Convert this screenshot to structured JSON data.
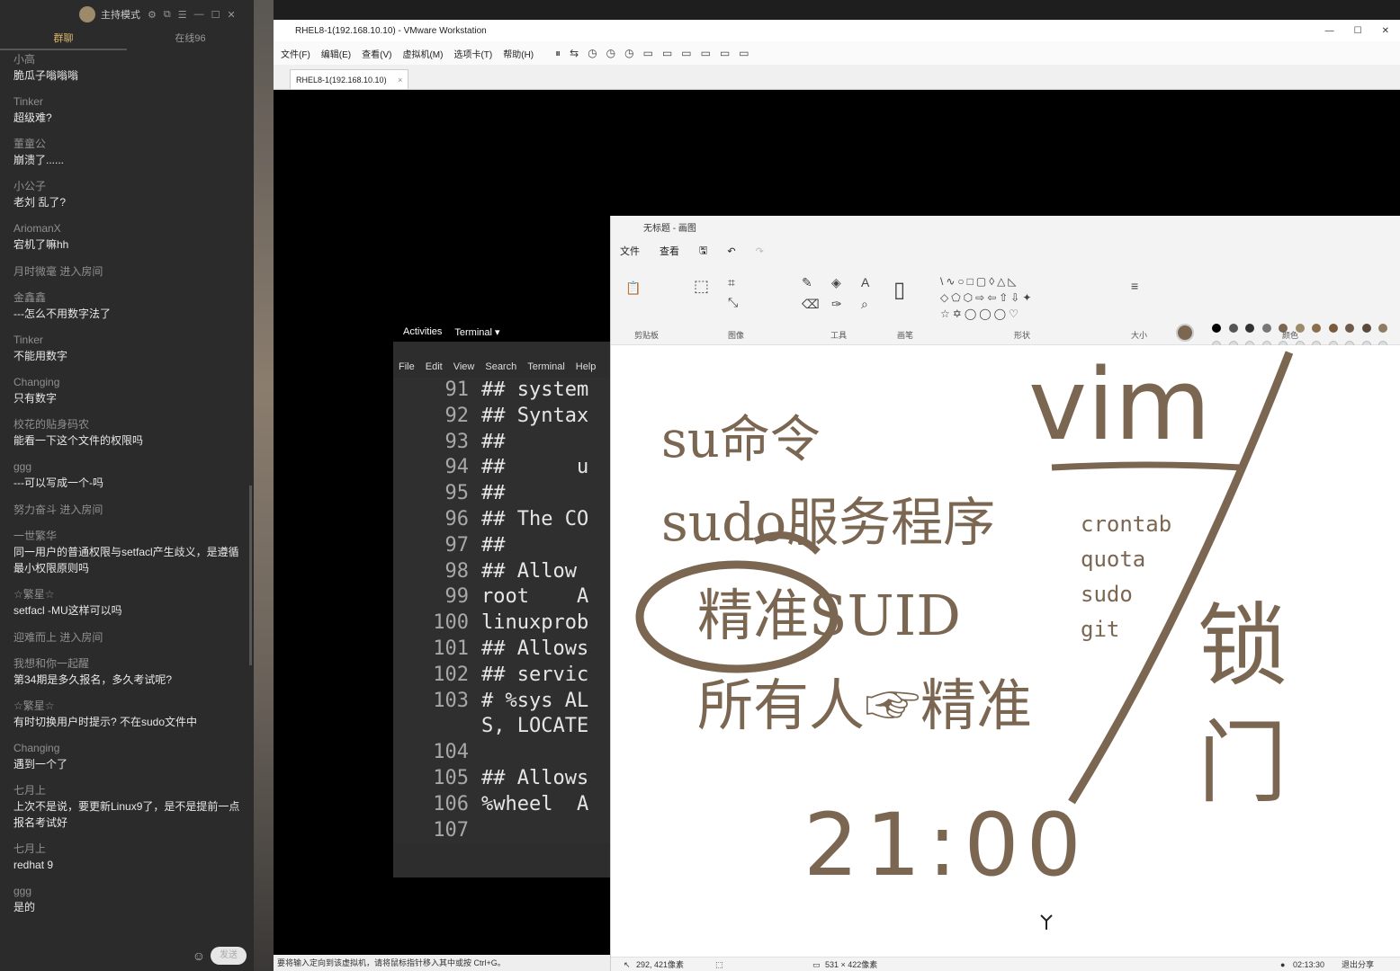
{
  "chat": {
    "host_label": "主持模式",
    "tabs": [
      "群聊",
      "在线96"
    ],
    "messages": [
      {
        "nick": "小高",
        "text": "脆瓜子嗡嗡嗡"
      },
      {
        "nick": "Tinker",
        "text": "超级难?"
      },
      {
        "nick": "董童公",
        "text": "崩溃了......"
      },
      {
        "nick": "小公子",
        "text": "老刘 乱了?"
      },
      {
        "nick": "AriomanX",
        "text": "宕机了嘛hh"
      },
      {
        "system": "月时微毫 进入房间"
      },
      {
        "nick": "金鑫鑫",
        "text": "---怎么不用数字法了"
      },
      {
        "nick": "Tinker",
        "text": "不能用数字"
      },
      {
        "nick": "Changing",
        "text": "只有数字"
      },
      {
        "nick": "校花的贴身码农",
        "text": "能看一下这个文件的权限吗"
      },
      {
        "nick": "ggg",
        "text": "---可以写成一个-吗"
      },
      {
        "system": "努力奋斗 进入房间"
      },
      {
        "nick": "一世繁华",
        "text": "同一用户的普通权限与setfacl产生歧义，是遵循最小权限原则吗"
      },
      {
        "nick": "☆繁星☆",
        "text": "setfacl   -MU这样可以吗"
      },
      {
        "system": "迎难而上 进入房间"
      },
      {
        "nick": "我想和你一起醒",
        "text": "第34期是多久报名，多久考试呢?"
      },
      {
        "nick": "☆繁星☆",
        "text": "有时切换用户时提示? 不在sudo文件中"
      },
      {
        "nick": "Changing",
        "text": "遇到一个了"
      },
      {
        "nick": "七月上",
        "text": "上次不是说，要更新Linux9了，是不是提前一点报名考试好"
      },
      {
        "nick": "七月上",
        "text": "redhat 9"
      },
      {
        "nick": "ggg",
        "text": "是的"
      }
    ],
    "send_label": "发送"
  },
  "vmware": {
    "title": "RHEL8-1(192.168.10.10) - VMware Workstation",
    "menu": [
      "文件(F)",
      "编辑(E)",
      "查看(V)",
      "虚拟机(M)",
      "选项卡(T)",
      "帮助(H)"
    ],
    "tab_label": "RHEL8-1(192.168.10.10)",
    "status_text": "要将输入定向到该虚拟机，请将鼠标指针移入其中或按 Ctrl+G。"
  },
  "gnome": {
    "activities": "Activities",
    "terminal": "Terminal ▾"
  },
  "terminal": {
    "menu": [
      "File",
      "Edit",
      "View",
      "Search",
      "Terminal",
      "Help"
    ],
    "lines": [
      {
        "n": "91",
        "t": "## system"
      },
      {
        "n": "92",
        "t": "## Syntax"
      },
      {
        "n": "93",
        "t": "##"
      },
      {
        "n": "94",
        "t": "##      u"
      },
      {
        "n": "95",
        "t": "##"
      },
      {
        "n": "96",
        "t": "## The CO"
      },
      {
        "n": "97",
        "t": "##"
      },
      {
        "n": "98",
        "t": "## Allow"
      },
      {
        "n": "99",
        "t": "root    A"
      },
      {
        "n": "100",
        "t": "linuxprob"
      },
      {
        "n": "101",
        "t": "## Allows"
      },
      {
        "n": "102",
        "t": "## servic"
      },
      {
        "n": "103",
        "t": "# %sys AL"
      },
      {
        "n": "",
        "t": "S, LOCATE"
      },
      {
        "n": "104",
        "t": ""
      },
      {
        "n": "105",
        "t": "## Allows"
      },
      {
        "n": "106",
        "t": "%wheel  A"
      },
      {
        "n": "107",
        "t": ""
      }
    ]
  },
  "paint": {
    "title": "无标题 - 画图",
    "menu": [
      "文件",
      "查看"
    ],
    "groups": [
      "剪贴板",
      "图像",
      "工具",
      "画笔",
      "形状",
      "大小",
      "颜色"
    ],
    "status": {
      "pos": "292, 421像素",
      "size": "531 × 422像素"
    },
    "clock": "02:13:30",
    "exit_share": "退出分享",
    "canvas": {
      "line1": "su命令",
      "line2": "sudo服务程序",
      "line3": "精准SUID",
      "line4": "所有人☞精准",
      "vim": "vim",
      "side_list": [
        "crontab",
        "quota",
        "sudo",
        "git"
      ],
      "right_char": "锁门",
      "time": "21:00"
    },
    "ink_color": "#7b6651"
  }
}
